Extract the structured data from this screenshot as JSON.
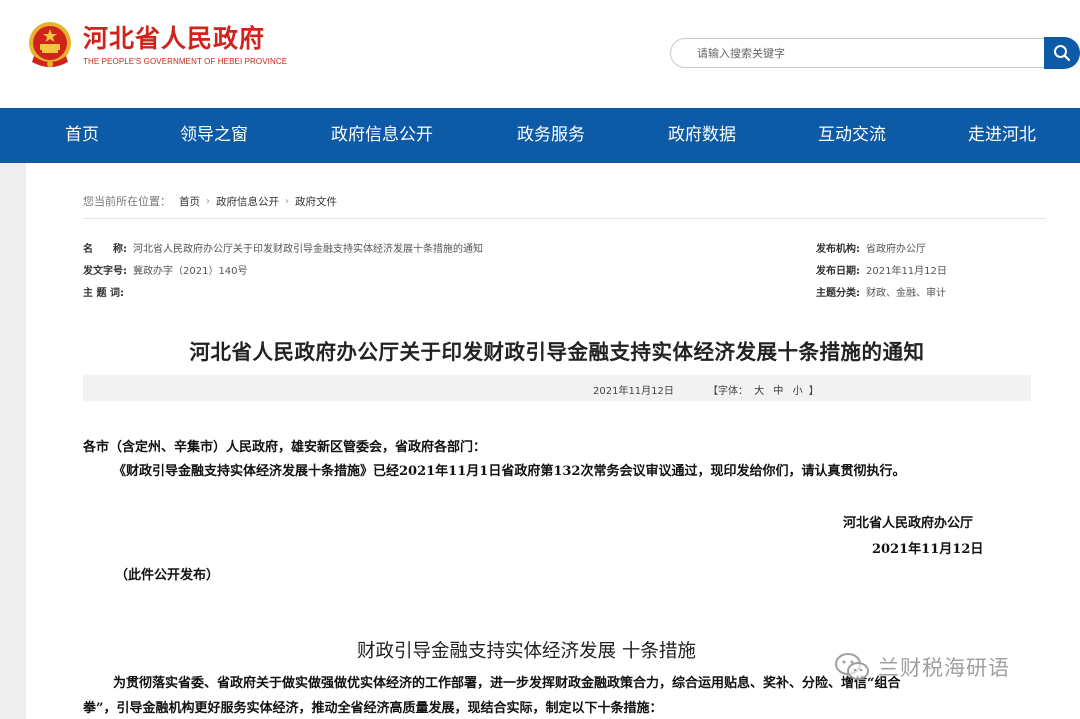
{
  "site": {
    "name_cn": "河北省人民政府",
    "name_en": "THE PEOPLE'S GOVERNMENT OF HEBEI PROVINCE"
  },
  "search": {
    "placeholder": "请输入搜索关键字"
  },
  "nav": {
    "items": [
      "首页",
      "领导之窗",
      "政府信息公开",
      "政务服务",
      "政府数据",
      "互动交流",
      "走进河北"
    ]
  },
  "breadcrumb": {
    "prefix": "您当前所在位置：",
    "items": [
      "首页",
      "政府信息公开",
      "政府文件"
    ]
  },
  "meta": {
    "name_label": "名　　称:",
    "name_value": "河北省人民政府办公厅关于印发财政引导金融支持实体经济发展十条措施的通知",
    "doc_no_label": "发文字号:",
    "doc_no_value": "冀政办字（2021）140号",
    "keywords_label": "主 题 词:",
    "keywords_value": "",
    "issuer_label": "发布机构:",
    "issuer_value": "省政府办公厅",
    "date_label": "发布日期:",
    "date_value": "2021年11月12日",
    "category_label": "主题分类:",
    "category_value": "财政、金融、审计"
  },
  "document": {
    "title": "河北省人民政府办公厅关于印发财政引导金融支持实体经济发展十条措施的通知",
    "pub_date": "2021年11月12日",
    "font_size_label": "【字体：",
    "font_large": "大",
    "font_medium": "中",
    "font_small": "小",
    "font_size_close": "】",
    "addressees": "各市（含定州、辛集市）人民政府，雄安新区管委会，省政府各部门：",
    "paragraph_1": "《财政引导金融支持实体经济发展十条措施》已经2021年11月1日省政府第132次常务会议审议通过，现印发给你们，请认真贯彻执行。",
    "signature": "河北省人民政府办公厅",
    "sign_date": "2021年11月12日",
    "public_note": "（此件公开发布）",
    "section_title": "财政引导金融支持实体经济发展  十条措施",
    "intro_line_1": "为贯彻落实省委、省政府关于做实做强做优实体经济的工作部署，进一步发挥财政金融政策合力，综合运用贴息、奖补、分险、增信“组合",
    "intro_line_2": "拳”，引导金融机构更好服务实体经济，推动全省经济高质量发展，现结合实际，制定以下十条措施："
  },
  "watermark": {
    "text": "兰财税海研语"
  },
  "colors": {
    "brand_red": "#d0231b",
    "nav_blue": "#0d5aa7"
  },
  "icons": {
    "emblem": "national-emblem-icon",
    "search": "search-icon",
    "watermark": "wechat-icon"
  }
}
